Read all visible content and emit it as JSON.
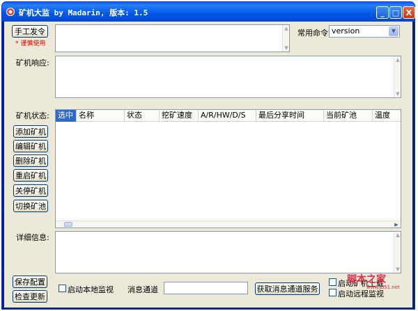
{
  "window": {
    "title": "矿机大监 by Madarin, 版本: 1.5",
    "controls": {
      "minimize": "_",
      "maximize": "□",
      "close": "X"
    }
  },
  "command": {
    "send_button": "手工发令",
    "warning": "* 谨慎使用",
    "input_value": "",
    "common_label": "常用命令",
    "common_selected": "version"
  },
  "response": {
    "label": "矿机响应:",
    "value": ""
  },
  "status": {
    "label": "矿机状态:",
    "columns": [
      "选中",
      "名称",
      "状态",
      "挖矿速度",
      "A/R/HW/D/S",
      "最后分享时间",
      "当前矿池",
      "温度"
    ],
    "rows": []
  },
  "side_buttons": {
    "add": "添加矿机",
    "edit": "编辑矿机",
    "delete": "删除矿机",
    "restart": "重启矿机",
    "stop": "关停矿机",
    "switch_pool": "切换矿池"
  },
  "detail": {
    "label": "详细信息:",
    "value": ""
  },
  "bottom": {
    "save_config": "保存配置",
    "check_update": "检查更新",
    "local_monitor": "启动本地监视",
    "channel_label": "消息通道",
    "channel_value": "",
    "get_channel_button": "获取消息通道服务",
    "option_upload": "启动矿机上载",
    "remote_monitor": "启动远程监视"
  },
  "watermark": {
    "text": "脚本之家",
    "sub": "www.jb51.net"
  },
  "colors": {
    "titlebar": "#0058e6",
    "face": "#ece9d8",
    "selected": "#316ac5",
    "warning": "#e00000"
  }
}
